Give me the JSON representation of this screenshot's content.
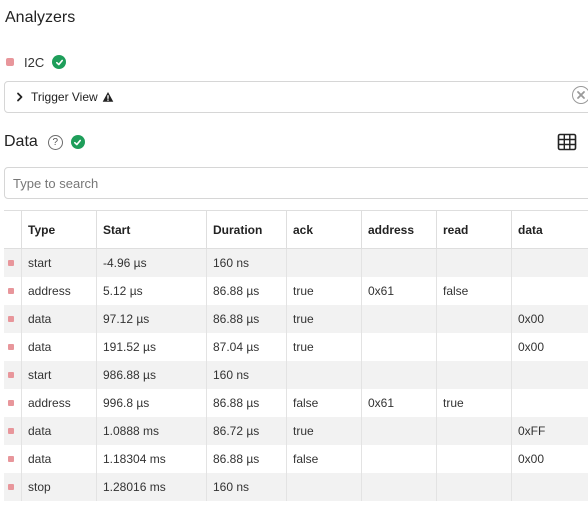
{
  "header": {
    "title": "Analyzers"
  },
  "analyzer": {
    "name": "I2C",
    "color": "#e8969b",
    "status_color": "#1e9e5a"
  },
  "trigger": {
    "label": "Trigger View"
  },
  "data_section": {
    "title": "Data",
    "help": "?"
  },
  "search": {
    "placeholder": "Type to search",
    "value": ""
  },
  "table": {
    "columns": [
      "",
      "Type",
      "Start",
      "Duration",
      "ack",
      "address",
      "read",
      "data"
    ],
    "rows": [
      [
        "start",
        "-4.96 µs",
        "160 ns",
        "",
        "",
        "",
        ""
      ],
      [
        "address",
        "5.12 µs",
        "86.88 µs",
        "true",
        "0x61",
        "false",
        ""
      ],
      [
        "data",
        "97.12 µs",
        "86.88 µs",
        "true",
        "",
        "",
        "0x00"
      ],
      [
        "data",
        "191.52 µs",
        "87.04 µs",
        "true",
        "",
        "",
        "0x00"
      ],
      [
        "start",
        "986.88 µs",
        "160 ns",
        "",
        "",
        "",
        ""
      ],
      [
        "address",
        "996.8 µs",
        "86.88 µs",
        "false",
        "0x61",
        "true",
        ""
      ],
      [
        "data",
        "1.0888 ms",
        "86.72 µs",
        "true",
        "",
        "",
        "0xFF"
      ],
      [
        "data",
        "1.18304 ms",
        "86.88 µs",
        "false",
        "",
        "",
        "0x00"
      ],
      [
        "stop",
        "1.28016 ms",
        "160 ns",
        "",
        "",
        "",
        ""
      ]
    ]
  }
}
